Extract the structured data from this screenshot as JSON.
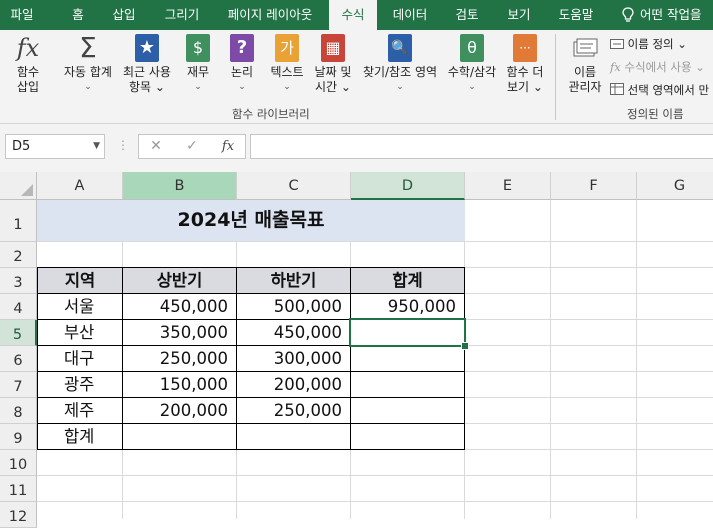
{
  "ribbon_tabs": [
    "파일",
    "홈",
    "삽입",
    "그리기",
    "페이지 레이아웃",
    "수식",
    "데이터",
    "검토",
    "보기",
    "도움말",
    "어떤 작업을"
  ],
  "active_tab": "수식",
  "function_library": {
    "insert_function": {
      "line1": "함수",
      "line2": "삽입"
    },
    "autosum": {
      "line1": "자동 합계",
      "line2": "⌄"
    },
    "recent": {
      "line1": "최근 사용",
      "line2": "항목 ⌄"
    },
    "financial": {
      "line1": "재무",
      "line2": "⌄"
    },
    "logical": {
      "line1": "논리",
      "line2": "⌄"
    },
    "text": {
      "line1": "텍스트",
      "line2": "⌄"
    },
    "datetime": {
      "line1": "날짜 및",
      "line2": "시간 ⌄"
    },
    "lookup": {
      "line1": "찾기/참조 영역",
      "line2": "⌄"
    },
    "math": {
      "line1": "수학/삼각",
      "line2": "⌄"
    },
    "more": {
      "line1": "함수 더",
      "line2": "보기 ⌄"
    },
    "group_label": "함수 라이브러리",
    "icon_glyphs": {
      "insert_function": "fx",
      "autosum": "Σ",
      "recent": "★",
      "financial": "$",
      "logical": "?",
      "text": "가",
      "datetime": "▦",
      "lookup": "🔍",
      "math": "θ",
      "more": "···"
    }
  },
  "defined_names": {
    "name_manager": {
      "line1": "이름",
      "line2": "관리자"
    },
    "define_name": "이름 정의 ⌄",
    "use_in_formula": "수식에서 사용 ⌄",
    "create_from_selection": "선택 영역에서 만",
    "group_label": "정의된 이름"
  },
  "formula_bar": {
    "name_box": "D5",
    "cancel_icon": "✕",
    "enter_icon": "✓",
    "fx_label": "fx",
    "formula": ""
  },
  "columns": [
    "A",
    "B",
    "C",
    "D",
    "E",
    "F",
    "G"
  ],
  "rows": [
    "1",
    "2",
    "3",
    "4",
    "5",
    "6",
    "7",
    "8",
    "9",
    "10",
    "11",
    "12"
  ],
  "sheet": {
    "title": "2024년 매출목표",
    "headers": [
      "지역",
      "상반기",
      "하반기",
      "합계"
    ],
    "data": [
      {
        "region": "서울",
        "h1": "450,000",
        "h2": "500,000",
        "total": "950,000"
      },
      {
        "region": "부산",
        "h1": "350,000",
        "h2": "450,000",
        "total": ""
      },
      {
        "region": "대구",
        "h1": "250,000",
        "h2": "300,000",
        "total": ""
      },
      {
        "region": "광주",
        "h1": "150,000",
        "h2": "200,000",
        "total": ""
      },
      {
        "region": "제주",
        "h1": "200,000",
        "h2": "250,000",
        "total": ""
      },
      {
        "region": "합계",
        "h1": "",
        "h2": "",
        "total": ""
      }
    ]
  },
  "selected_cell": "D5",
  "colors": {
    "ribbon_green": "#217346",
    "title_fill": "#dce3f1",
    "header_fill": "#d9dbe0"
  }
}
